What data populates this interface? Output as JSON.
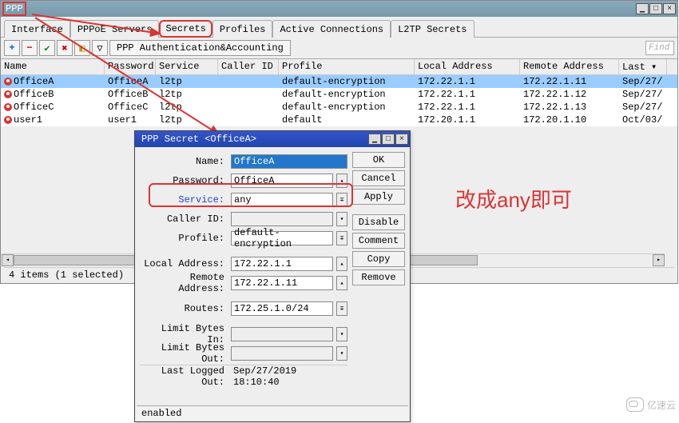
{
  "mainWindow": {
    "title": "PPP"
  },
  "tabs": [
    "Interface",
    "PPPoE Servers",
    "Secrets",
    "Profiles",
    "Active Connections",
    "L2TP Secrets"
  ],
  "activeTabHighlight": 2,
  "toolbar": {
    "paa": "PPP Authentication&Accounting",
    "find": "Find"
  },
  "columns": [
    "Name",
    "Password",
    "Service",
    "Caller ID",
    "Profile",
    "Local Address",
    "Remote Address",
    "Last ▾"
  ],
  "rows": [
    {
      "name": "OfficeA",
      "password": "OfficeA",
      "service": "l2tp",
      "callerId": "",
      "profile": "default-encryption",
      "local": "172.22.1.1",
      "remote": "172.22.1.11",
      "last": "Sep/27/"
    },
    {
      "name": "OfficeB",
      "password": "OfficeB",
      "service": "l2tp",
      "callerId": "",
      "profile": "default-encryption",
      "local": "172.22.1.1",
      "remote": "172.22.1.12",
      "last": "Sep/27/"
    },
    {
      "name": "OfficeC",
      "password": "OfficeC",
      "service": "l2tp",
      "callerId": "",
      "profile": "default-encryption",
      "local": "172.22.1.1",
      "remote": "172.22.1.13",
      "last": "Sep/27/"
    },
    {
      "name": "user1",
      "password": "user1",
      "service": "l2tp",
      "callerId": "",
      "profile": "default",
      "local": "172.20.1.1",
      "remote": "172.20.1.10",
      "last": "Oct/03/"
    }
  ],
  "selectedRow": 0,
  "status": "4 items (1 selected)",
  "dialog": {
    "title": "PPP Secret <OfficeA>",
    "fields": {
      "nameLabel": "Name:",
      "nameValue": "OfficeA",
      "passwordLabel": "Password:",
      "passwordValue": "OfficeA",
      "serviceLabel": "Service:",
      "serviceValue": "any",
      "callerIdLabel": "Caller ID:",
      "callerIdValue": "",
      "profileLabel": "Profile:",
      "profileValue": "default-encryption",
      "localAddrLabel": "Local Address:",
      "localAddrValue": "172.22.1.1",
      "remoteAddrLabel": "Remote Address:",
      "remoteAddrValue": "172.22.1.11",
      "routesLabel": "Routes:",
      "routesValue": "172.25.1.0/24",
      "limitInLabel": "Limit Bytes In:",
      "limitInValue": "",
      "limitOutLabel": "Limit Bytes Out:",
      "limitOutValue": "",
      "lastLoggedLabel": "Last Logged Out:",
      "lastLoggedValue": "Sep/27/2019 18:10:40"
    },
    "buttons": [
      "OK",
      "Cancel",
      "Apply",
      "Disable",
      "Comment",
      "Copy",
      "Remove"
    ],
    "status": "enabled"
  },
  "annotation": "改成any即可",
  "watermark": "亿速云"
}
